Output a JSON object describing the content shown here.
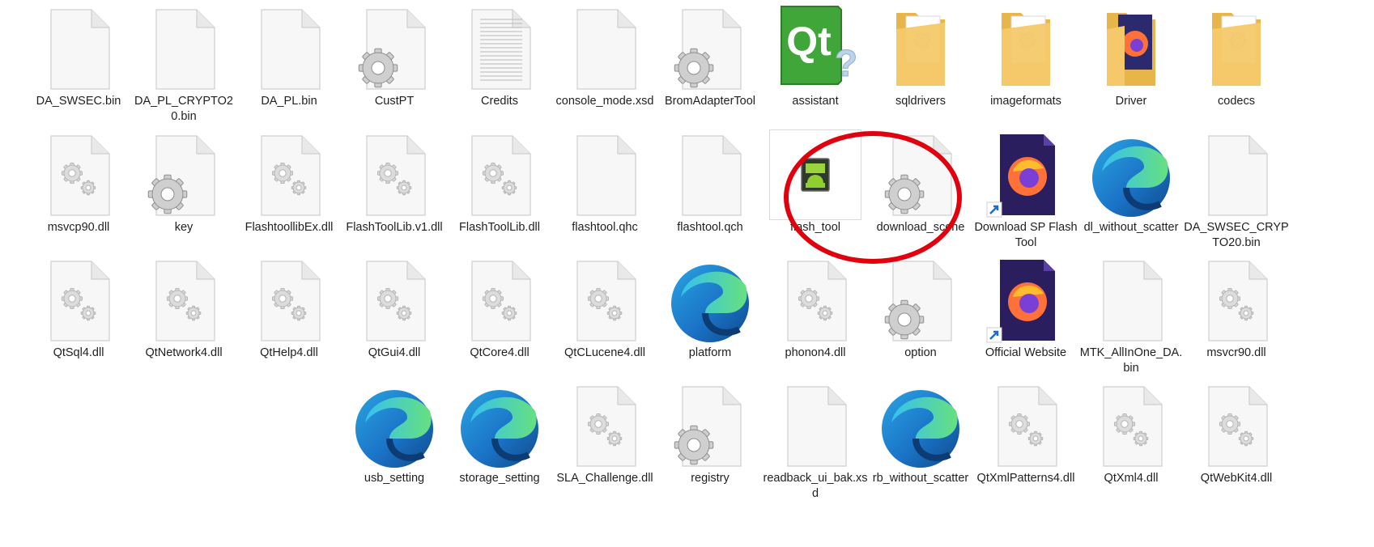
{
  "window": {
    "view": "Large icons"
  },
  "files": [
    {
      "name": "DA_SWSEC.bin",
      "icon": "blank-file-icon"
    },
    {
      "name": "DA_PL_CRYPTO20.bin",
      "icon": "blank-file-icon"
    },
    {
      "name": "DA_PL.bin",
      "icon": "blank-file-icon"
    },
    {
      "name": "CustPT",
      "icon": "application-gear-icon"
    },
    {
      "name": "Credits",
      "icon": "text-document-icon"
    },
    {
      "name": "console_mode.xsd",
      "icon": "blank-file-icon"
    },
    {
      "name": "BromAdapterTool",
      "icon": "application-gear-icon"
    },
    {
      "name": "assistant",
      "icon": "qt-assistant-icon"
    },
    {
      "name": "sqldrivers",
      "icon": "folder-icon"
    },
    {
      "name": "imageformats",
      "icon": "folder-icon"
    },
    {
      "name": "Driver",
      "icon": "folder-firefox-icon"
    },
    {
      "name": "codecs",
      "icon": "folder-icon"
    },
    {
      "name": "msvcp90.dll",
      "icon": "dll-file-icon"
    },
    {
      "name": "key",
      "icon": "application-gear-icon"
    },
    {
      "name": "FlashtoollibEx.dll",
      "icon": "dll-file-icon"
    },
    {
      "name": "FlashToolLib.v1.dll",
      "icon": "dll-file-icon"
    },
    {
      "name": "FlashToolLib.dll",
      "icon": "dll-file-icon"
    },
    {
      "name": "flashtool.qhc",
      "icon": "blank-file-icon"
    },
    {
      "name": "flashtool.qch",
      "icon": "blank-file-icon"
    },
    {
      "name": "flash_tool",
      "icon": "android-app-icon",
      "selected": true
    },
    {
      "name": "download_scene",
      "icon": "application-gear-icon"
    },
    {
      "name": "Download SP Flash Tool",
      "icon": "firefox-shortcut-icon",
      "shortcut": true
    },
    {
      "name": "dl_without_scatter",
      "icon": "edge-icon"
    },
    {
      "name": "DA_SWSEC_CRYPTO20.bin",
      "icon": "blank-file-icon"
    },
    {
      "name": "QtSql4.dll",
      "icon": "dll-file-icon"
    },
    {
      "name": "QtNetwork4.dll",
      "icon": "dll-file-icon"
    },
    {
      "name": "QtHelp4.dll",
      "icon": "dll-file-icon"
    },
    {
      "name": "QtGui4.dll",
      "icon": "dll-file-icon"
    },
    {
      "name": "QtCore4.dll",
      "icon": "dll-file-icon"
    },
    {
      "name": "QtCLucene4.dll",
      "icon": "dll-file-icon"
    },
    {
      "name": "platform",
      "icon": "edge-icon"
    },
    {
      "name": "phonon4.dll",
      "icon": "dll-file-icon"
    },
    {
      "name": "option",
      "icon": "application-gear-icon"
    },
    {
      "name": "Official Website",
      "icon": "firefox-shortcut-icon",
      "shortcut": true
    },
    {
      "name": "MTK_AllInOne_DA.bin",
      "icon": "blank-file-icon"
    },
    {
      "name": "msvcr90.dll",
      "icon": "dll-file-icon"
    },
    {
      "name": "usb_setting",
      "icon": "edge-icon"
    },
    {
      "name": "storage_setting",
      "icon": "edge-icon"
    },
    {
      "name": "SLA_Challenge.dll",
      "icon": "dll-file-icon"
    },
    {
      "name": "registry",
      "icon": "application-gear-icon"
    },
    {
      "name": "readback_ui_bak.xsd",
      "icon": "blank-file-icon"
    },
    {
      "name": "rb_without_scatter",
      "icon": "edge-icon"
    },
    {
      "name": "QtXmlPatterns4.dll",
      "icon": "dll-file-icon"
    },
    {
      "name": "QtXml4.dll",
      "icon": "dll-file-icon"
    },
    {
      "name": "QtWebKit4.dll",
      "icon": "dll-file-icon"
    }
  ],
  "annotation": {
    "highlight_color": "#e0000e",
    "highlighted_item": "flash_tool"
  },
  "colors": {
    "label_text": "#1f1f1f",
    "folder": "#f5c96a",
    "edge_blue": "#1b74c8",
    "edge_green": "#5fd08a"
  }
}
